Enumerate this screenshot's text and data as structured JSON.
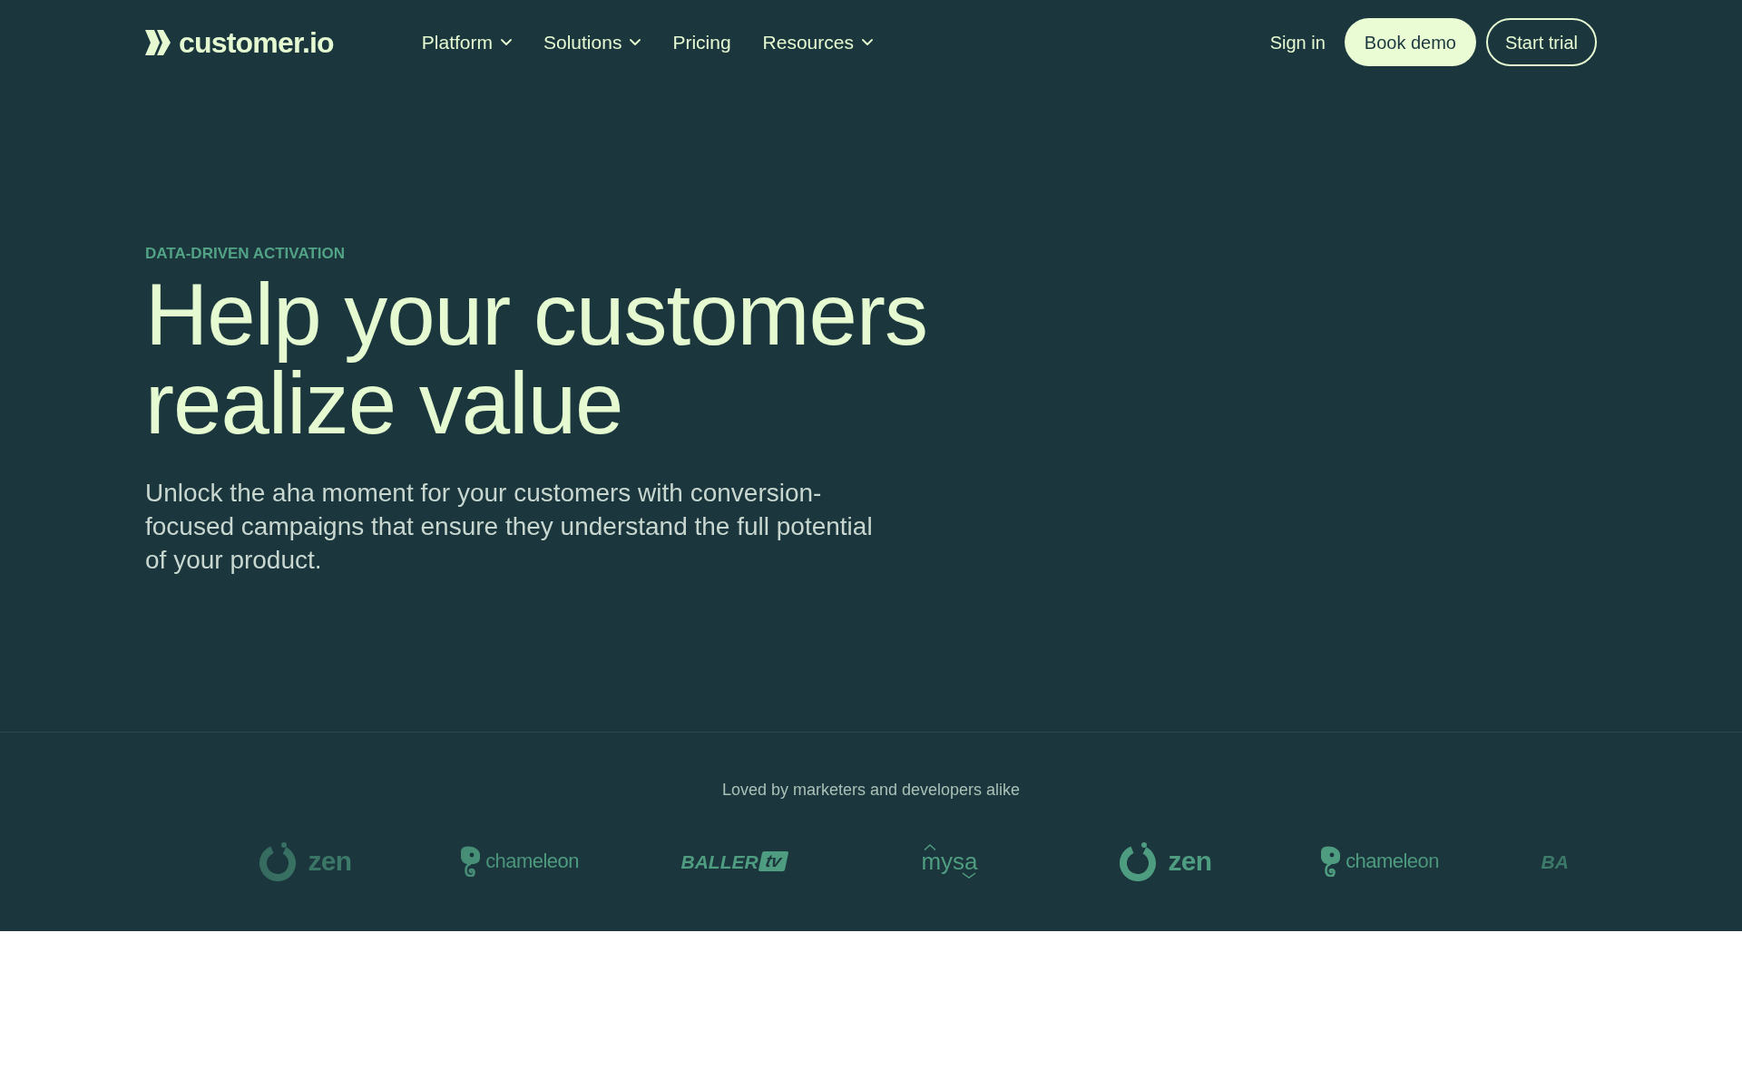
{
  "nav": {
    "brand": {
      "name": "customer.io"
    },
    "links": [
      {
        "label": "Platform",
        "has_menu": true
      },
      {
        "label": "Solutions",
        "has_menu": true
      },
      {
        "label": "Pricing",
        "has_menu": false
      },
      {
        "label": "Resources",
        "has_menu": true
      }
    ],
    "actions": [
      {
        "label": "Sign in",
        "kind": "link"
      },
      {
        "label": "Book demo",
        "kind": "primary"
      },
      {
        "label": "Start trial",
        "kind": "outline"
      }
    ]
  },
  "hero": {
    "eyebrow": "DATA-DRIVEN ACTIVATION",
    "title": "Help your customers realize value",
    "description": "Unlock the aha moment for your customers with conversion-focused campaigns that ensure they understand the full potential of your product."
  },
  "customers": {
    "caption": "Loved by marketers and developers alike",
    "logos": [
      {
        "kind": "zen",
        "name": "zen"
      },
      {
        "kind": "chameleon",
        "name": "chameleon"
      },
      {
        "kind": "baller",
        "name": "BALLER",
        "badge": "tv"
      },
      {
        "kind": "mysa",
        "name": "mysa"
      },
      {
        "kind": "zen",
        "name": "zen"
      },
      {
        "kind": "chameleon",
        "name": "chameleon"
      },
      {
        "kind": "baller",
        "name": "BA"
      }
    ]
  }
}
